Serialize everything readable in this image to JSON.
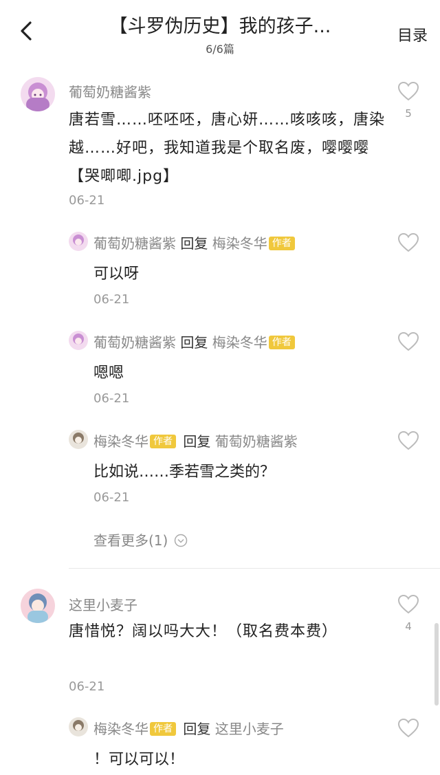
{
  "header": {
    "title": "【斗罗伪历史】我的孩子...",
    "subtitle": "6/6篇",
    "menu_label": "目录"
  },
  "labels": {
    "reply_word": "回复",
    "author_badge": "作者",
    "view_more": "查看更多(1)"
  },
  "comments": [
    {
      "user": "葡萄奶糖酱紫",
      "text": "唐若雪……呸呸呸，唐心妍……咳咳咳，唐染越……好吧，我知道我是个取名废，嘤嘤嘤【哭唧唧.jpg】",
      "date": "06-21",
      "likes": "5",
      "replies": [
        {
          "user": "葡萄奶糖酱紫",
          "target": "梅染冬华",
          "target_is_author": true,
          "text": "可以呀",
          "date": "06-21"
        },
        {
          "user": "葡萄奶糖酱紫",
          "target": "梅染冬华",
          "target_is_author": true,
          "text": "嗯嗯",
          "date": "06-21"
        },
        {
          "user": "梅染冬华",
          "user_is_author": true,
          "target": "葡萄奶糖酱紫",
          "text": "比如说……季若雪之类的？",
          "date": "06-21"
        }
      ]
    },
    {
      "user": "这里小麦子",
      "text": "唐惜悦？阔以吗大大！（取名费本费）",
      "date": "06-21",
      "likes": "4",
      "replies": [
        {
          "user": "梅染冬华",
          "user_is_author": true,
          "target": "这里小麦子",
          "text": "！可以可以！"
        }
      ]
    }
  ],
  "colors": {
    "author_badge": "#f0c83c",
    "muted_text": "#888888",
    "date_text": "#999999"
  }
}
